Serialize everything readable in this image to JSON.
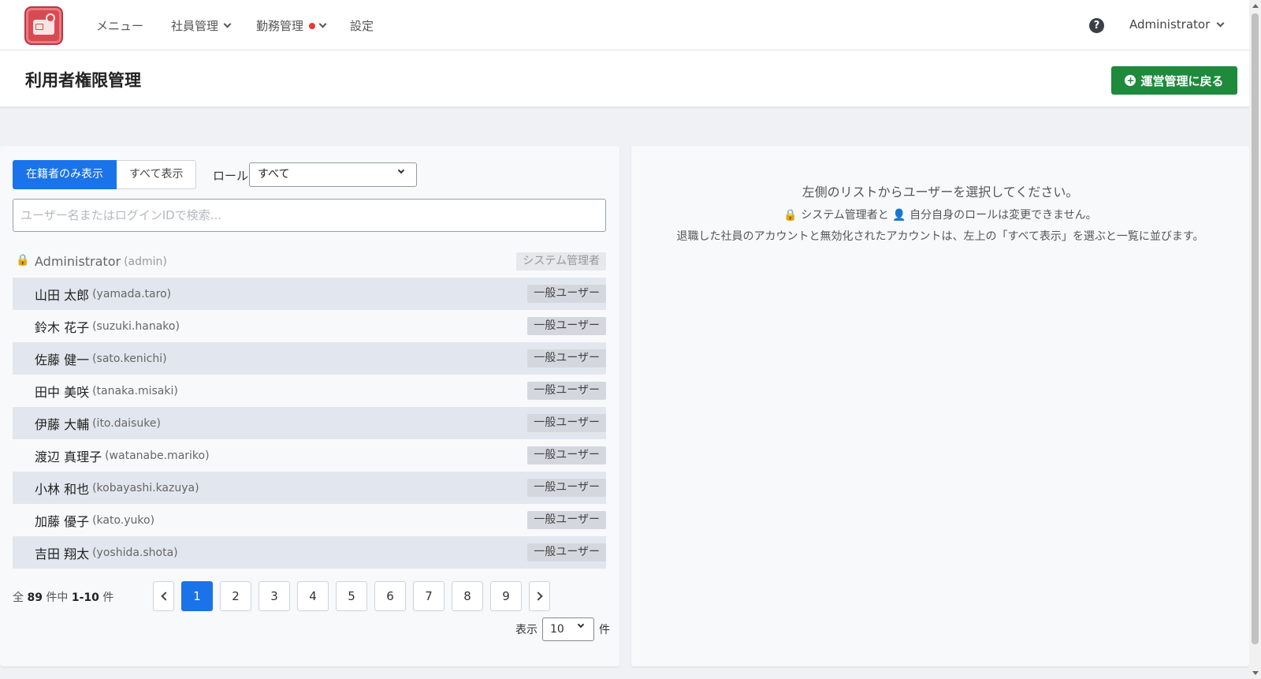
{
  "nav": {
    "menu": "メニュー",
    "employees": "社員管理",
    "attendance": "勤務管理",
    "settings": "設定",
    "user": "Administrator",
    "help_icon": "question-circle"
  },
  "header": {
    "title": "利用者権限管理",
    "back_button": "運営管理に戻る"
  },
  "filters": {
    "active_only": "在籍者のみ表示",
    "show_all": "すべて表示",
    "role_label": "ロール",
    "role_value": "すべて",
    "search_placeholder": "ユーザー名またはログインIDで検索..."
  },
  "users": [
    {
      "name": "Administrator",
      "id": "(admin)",
      "role": "システム管理者",
      "locked": true
    },
    {
      "name": "山田 太郎",
      "id": "(yamada.taro)",
      "role": "一般ユーザー"
    },
    {
      "name": "鈴木 花子",
      "id": "(suzuki.hanako)",
      "role": "一般ユーザー"
    },
    {
      "name": "佐藤 健一",
      "id": "(sato.kenichi)",
      "role": "一般ユーザー"
    },
    {
      "name": "田中 美咲",
      "id": "(tanaka.misaki)",
      "role": "一般ユーザー"
    },
    {
      "name": "伊藤 大輔",
      "id": "(ito.daisuke)",
      "role": "一般ユーザー"
    },
    {
      "name": "渡辺 真理子",
      "id": "(watanabe.mariko)",
      "role": "一般ユーザー"
    },
    {
      "name": "小林 和也",
      "id": "(kobayashi.kazuya)",
      "role": "一般ユーザー"
    },
    {
      "name": "加藤 優子",
      "id": "(kato.yuko)",
      "role": "一般ユーザー"
    },
    {
      "name": "吉田 翔太",
      "id": "(yoshida.shota)",
      "role": "一般ユーザー"
    }
  ],
  "summary": {
    "prefix": "全",
    "total": "89",
    "middle": "件中",
    "range": "1-10",
    "suffix": "件"
  },
  "pagination": {
    "pages": [
      "1",
      "2",
      "3",
      "4",
      "5",
      "6",
      "7",
      "8",
      "9"
    ],
    "current": "1",
    "per_page_label": "表示",
    "per_page_value": "10",
    "per_page_suffix": "件"
  },
  "detail": {
    "hint_main": "左側のリストからユーザーを選択してください。",
    "hint_note": "🔒 システム管理者と 👤 自分自身のロールは変更できません。",
    "hint_retired": "退職した社員のアカウントと無効化されたアカウントは、左上の「すべて表示」を選ぶと一覧に並びます。"
  },
  "colors": {
    "primary": "#1a73e8",
    "success": "#1e8a3c",
    "alert_dot": "#e53935",
    "logo": "#d84a52"
  }
}
